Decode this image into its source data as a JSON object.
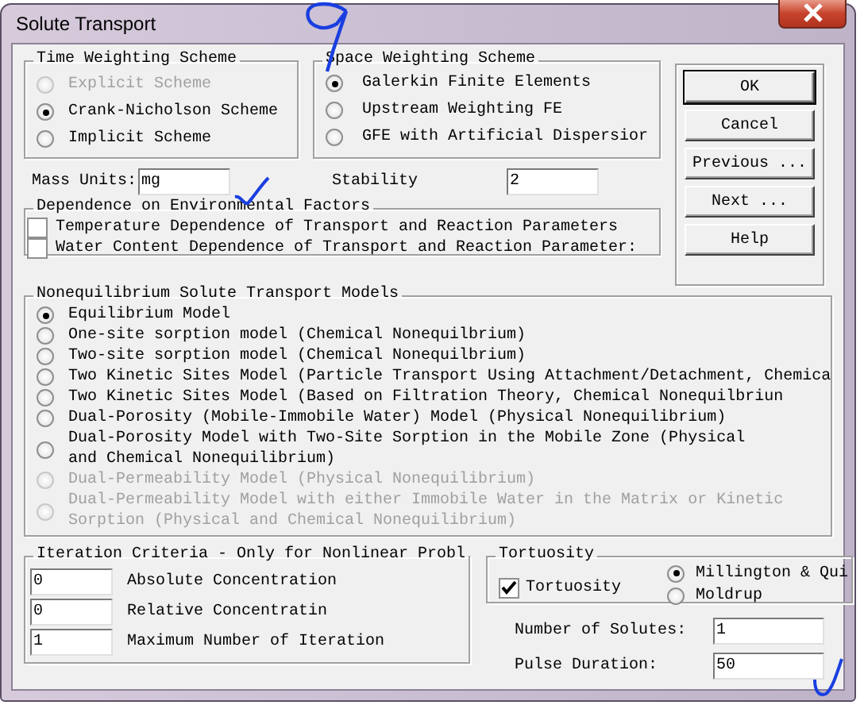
{
  "window": {
    "title": "Solute Transport"
  },
  "time_weighting": {
    "title": "Time Weighting Scheme",
    "options": [
      {
        "label": "Explicit Scheme",
        "selected": false,
        "disabled": true
      },
      {
        "label": "Crank-Nicholson Scheme",
        "selected": true,
        "disabled": false
      },
      {
        "label": "Implicit Scheme",
        "selected": false,
        "disabled": false
      }
    ]
  },
  "space_weighting": {
    "title": "Space Weighting Scheme",
    "options": [
      {
        "label": "Galerkin Finite Elements",
        "selected": true,
        "disabled": false
      },
      {
        "label": "Upstream Weighting FE",
        "selected": false,
        "disabled": false
      },
      {
        "label": "GFE with Artificial Dispersior",
        "selected": false,
        "disabled": false
      }
    ]
  },
  "mass_units": {
    "label": "Mass Units:",
    "value": "mg"
  },
  "stability": {
    "label": "Stability",
    "value": "2"
  },
  "buttons": [
    {
      "label": "OK",
      "default": true
    },
    {
      "label": "Cancel",
      "default": false
    },
    {
      "label": "Previous ...",
      "default": false
    },
    {
      "label": "Next ...",
      "default": false
    },
    {
      "label": "Help",
      "default": false
    }
  ],
  "environmental_factors": {
    "title": "Dependence on Environmental Factors",
    "options": [
      {
        "label": "Temperature Dependence of Transport and Reaction Parameters",
        "checked": false
      },
      {
        "label": "Water Content Dependence of Transport and Reaction Parameter:",
        "checked": false
      }
    ]
  },
  "models": {
    "title": "Nonequilibrium Solute Transport Models",
    "options": [
      {
        "label": "Equilibrium Model",
        "selected": true,
        "disabled": false
      },
      {
        "label": "One-site sorption model (Chemical Nonequilbrium)",
        "selected": false,
        "disabled": false
      },
      {
        "label": "Two-site sorption model (Chemical Nonequilbrium)",
        "selected": false,
        "disabled": false
      },
      {
        "label": "Two Kinetic Sites Model (Particle Transport Using Attachment/Detachment, Chemica",
        "selected": false,
        "disabled": false
      },
      {
        "label": "Two Kinetic Sites Model (Based on Filtration Theory, Chemical Nonequilbriun",
        "selected": false,
        "disabled": false
      },
      {
        "label": "Dual-Porosity (Mobile-Immobile Water) Model (Physical Nonequilibrium)",
        "selected": false,
        "disabled": false
      },
      {
        "label": "Dual-Porosity Model with Two-Site Sorption in the Mobile Zone (Physical\nand Chemical Nonequilibrium)",
        "selected": false,
        "disabled": false
      },
      {
        "label": "Dual-Permeability Model (Physical Nonequilibrium)",
        "selected": false,
        "disabled": true
      },
      {
        "label": "Dual-Permeability Model with either Immobile Water in the Matrix or Kinetic\nSorption (Physical and Chemical Nonequilibrium)",
        "selected": false,
        "disabled": true
      }
    ]
  },
  "iteration_criteria": {
    "title": "Iteration Criteria - Only for Nonlinear Probl",
    "fields": [
      {
        "value": "0",
        "label": "Absolute Concentration"
      },
      {
        "value": "0",
        "label": "Relative Concentratin"
      },
      {
        "value": "1",
        "label": "Maximum Number of Iteration"
      }
    ]
  },
  "tortuosity": {
    "title": "Tortuosity",
    "use_factor": {
      "label": "Tortuosity",
      "checked": true
    },
    "options": [
      {
        "label": "Millington & Qui",
        "selected": true
      },
      {
        "label": "Moldrup",
        "selected": false
      }
    ]
  },
  "number_of_solutes": {
    "label": "Number of Solutes:",
    "value": "1"
  },
  "pulse_duration": {
    "label": "Pulse Duration:",
    "value": "50"
  }
}
